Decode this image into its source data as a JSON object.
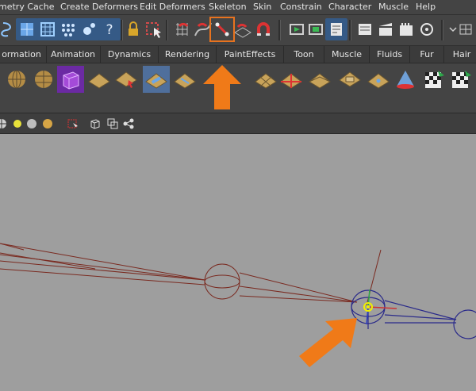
{
  "menu": {
    "items": [
      "metry Cache",
      "Create Deformers",
      "Edit Deformers",
      "Skeleton",
      "Skin",
      "Constrain",
      "Character",
      "Muscle",
      "Help"
    ]
  },
  "shelf_tabs": [
    "ormation",
    "Animation",
    "Dynamics",
    "Rendering",
    "PaintEffects",
    "Toon",
    "Muscle",
    "Fluids",
    "Fur",
    "Hair"
  ],
  "colors": {
    "ui_bg": "#444444",
    "viewport_bg": "#9e9e9e",
    "highlight": "#e8731f",
    "joint_red": "#7a2a20",
    "joint_blue": "#2a2a8a"
  },
  "icons": {
    "toolbar": [
      "lasso-icon",
      "select-icon",
      "lattice-icon",
      "vertex-icon",
      "camera-icon",
      "help-icon",
      "lock-icon",
      "select-tool-icon",
      "grid-snap-icon",
      "curve-snap-icon",
      "point-snap-icon",
      "plane-snap-icon",
      "magnet-icon",
      "render-region-icon",
      "render-icon",
      "ipr-icon",
      "render-settings-icon",
      "clapboard-icon",
      "batch-render-icon",
      "bake-icon",
      "layout-icon"
    ],
    "shelf": [
      "sphere-icon",
      "sphere-icon",
      "sphere-icon",
      "cube-icon",
      "plane-icon",
      "plane-icon",
      "plane-icon",
      "plane-icon",
      "plane-icon",
      "plane-icon",
      "plane-icon",
      "plane-icon",
      "plane-icon",
      "plane-icon",
      "cone-icon",
      "checker-icon",
      "checker-icon"
    ]
  }
}
